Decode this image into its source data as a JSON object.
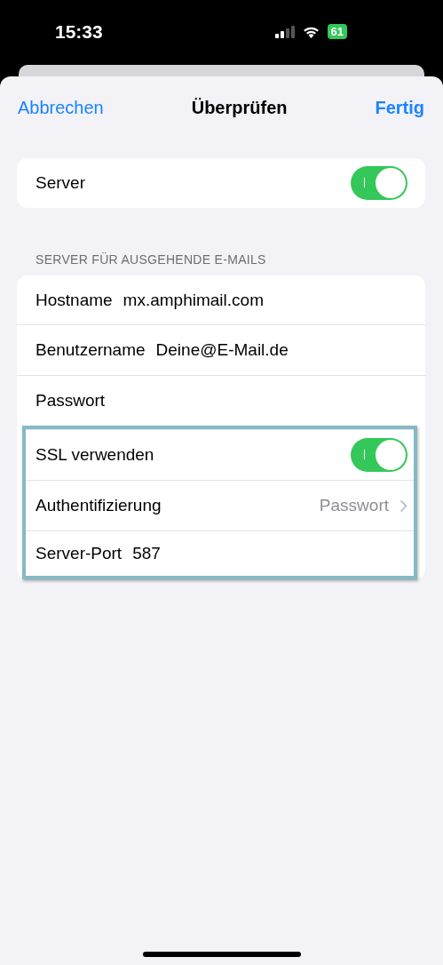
{
  "status_bar": {
    "time": "15:33",
    "battery": "61"
  },
  "nav": {
    "cancel": "Abbrechen",
    "title": "Überprüfen",
    "done": "Fertig"
  },
  "server": {
    "label": "Server",
    "on": true
  },
  "section": {
    "header": "SERVER FÜR AUSGEHENDE E-MAILS",
    "rows": [
      {
        "kind": "field",
        "label": "Hostname",
        "value": "mx.amphimail.com",
        "highlighted": false
      },
      {
        "kind": "field",
        "label": "Benutzername",
        "value": "Deine@E-Mail.de",
        "highlighted": false
      },
      {
        "kind": "field",
        "label": "Passwort",
        "highlighted": false
      },
      {
        "kind": "toggle",
        "label": "SSL verwenden",
        "on": true,
        "highlighted": true
      },
      {
        "kind": "link",
        "label": "Authentifizierung",
        "value": "Passwort",
        "highlighted": true
      },
      {
        "kind": "field",
        "label": "Server-Port",
        "value": "587",
        "highlighted": true
      }
    ]
  }
}
